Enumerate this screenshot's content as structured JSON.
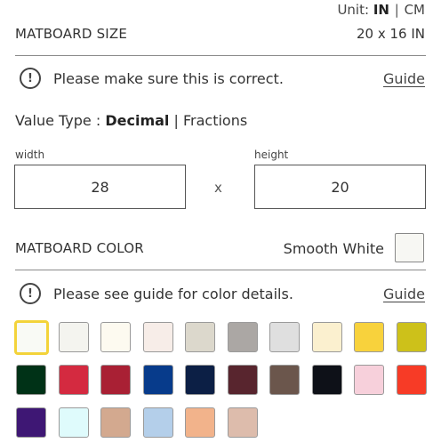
{
  "units": {
    "label": "Unit:",
    "options": [
      "IN",
      "CM"
    ],
    "active": "IN",
    "separator": "|"
  },
  "matboard_size": {
    "label": "MATBOARD SIZE",
    "value": "20 x 16 IN"
  },
  "size_notice": {
    "icon_glyph": "!",
    "text": "Please make sure this is correct.",
    "link": "Guide"
  },
  "value_type": {
    "label": "Value Type :",
    "options": [
      "Decimal",
      "Fractions"
    ],
    "active": "Decimal",
    "separator": "|"
  },
  "dimensions": {
    "width_label": "width",
    "width_value": "28",
    "times": "x",
    "height_label": "height",
    "height_value": "20"
  },
  "matboard_color": {
    "label": "MATBOARD COLOR",
    "selected_name": "Smooth White",
    "selected_color": "#f7f7f3"
  },
  "color_notice": {
    "icon_glyph": "!",
    "text": "Please see guide for color details.",
    "link": "Guide"
  },
  "swatches": [
    {
      "color": "#f9faf5",
      "selected": true
    },
    {
      "color": "#f4f4ef"
    },
    {
      "color": "#fdfaf0"
    },
    {
      "color": "#f7ede8"
    },
    {
      "color": "#dcd8cc"
    },
    {
      "color": "#aba7a4"
    },
    {
      "color": "#dfdfdf"
    },
    {
      "color": "#fbf0cf"
    },
    {
      "color": "#f8d23c"
    },
    {
      "color": "#cdc11a"
    },
    {
      "color": "#003217"
    },
    {
      "color": "#d42a40"
    },
    {
      "color": "#a92034"
    },
    {
      "color": "#073b8b"
    },
    {
      "color": "#0c1f45"
    },
    {
      "color": "#58252e"
    },
    {
      "color": "#6b564c"
    },
    {
      "color": "#0e1118"
    },
    {
      "color": "#f7d0db"
    },
    {
      "color": "#f73b26"
    },
    {
      "color": "#3e1774"
    },
    {
      "color": "#dffbfc"
    },
    {
      "color": "#d3a98f"
    },
    {
      "color": "#b4cfea"
    },
    {
      "color": "#f2b38b"
    },
    {
      "color": "#ddbcac"
    }
  ]
}
